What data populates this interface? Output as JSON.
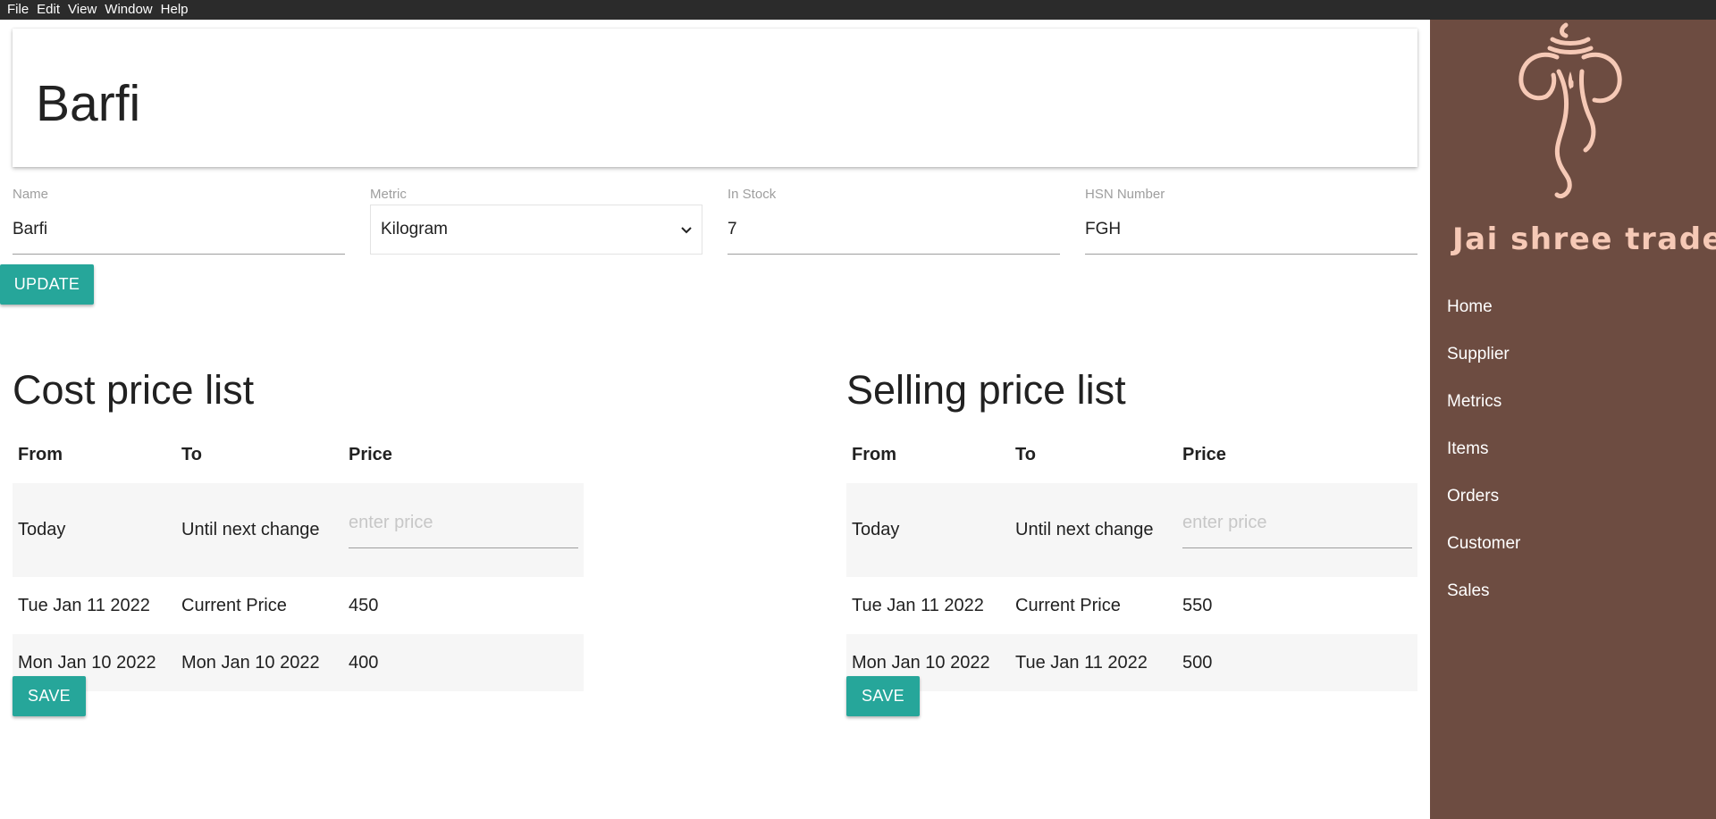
{
  "menubar": {
    "items": [
      "File",
      "Edit",
      "View",
      "Window",
      "Help"
    ]
  },
  "header": {
    "title": "Barfi"
  },
  "form": {
    "name": {
      "label": "Name",
      "value": "Barfi"
    },
    "metric": {
      "label": "Metric",
      "value": "Kilogram"
    },
    "in_stock": {
      "label": "In Stock",
      "value": "7"
    },
    "hsn": {
      "label": "HSN Number",
      "value": "FGH"
    },
    "update_label": "UPDATE"
  },
  "cost": {
    "title": "Cost price list",
    "headers": [
      "From",
      "To",
      "Price"
    ],
    "entry": {
      "from": "Today",
      "to": "Until next change",
      "placeholder": "enter price"
    },
    "rows": [
      {
        "from": "Tue Jan 11 2022",
        "to": "Current Price",
        "price": "450"
      },
      {
        "from": "Mon Jan 10 2022",
        "to": "Mon Jan 10 2022",
        "price": "400"
      }
    ],
    "save_label": "SAVE"
  },
  "selling": {
    "title": "Selling price list",
    "headers": [
      "From",
      "To",
      "Price"
    ],
    "entry": {
      "from": "Today",
      "to": "Until next change",
      "placeholder": "enter price"
    },
    "rows": [
      {
        "from": "Tue Jan 11 2022",
        "to": "Current Price",
        "price": "550"
      },
      {
        "from": "Mon Jan 10 2022",
        "to": "Tue Jan 11 2022",
        "price": "500"
      }
    ],
    "save_label": "SAVE"
  },
  "sidebar": {
    "brand": "Jai shree traders",
    "items": [
      "Home",
      "Supplier",
      "Metrics",
      "Items",
      "Orders",
      "Customer",
      "Sales"
    ]
  },
  "colors": {
    "accent": "#26a69a",
    "sidebar": "#6d4c41",
    "brand_text": "#f6c9b6",
    "menubar": "#2b2b2b"
  }
}
